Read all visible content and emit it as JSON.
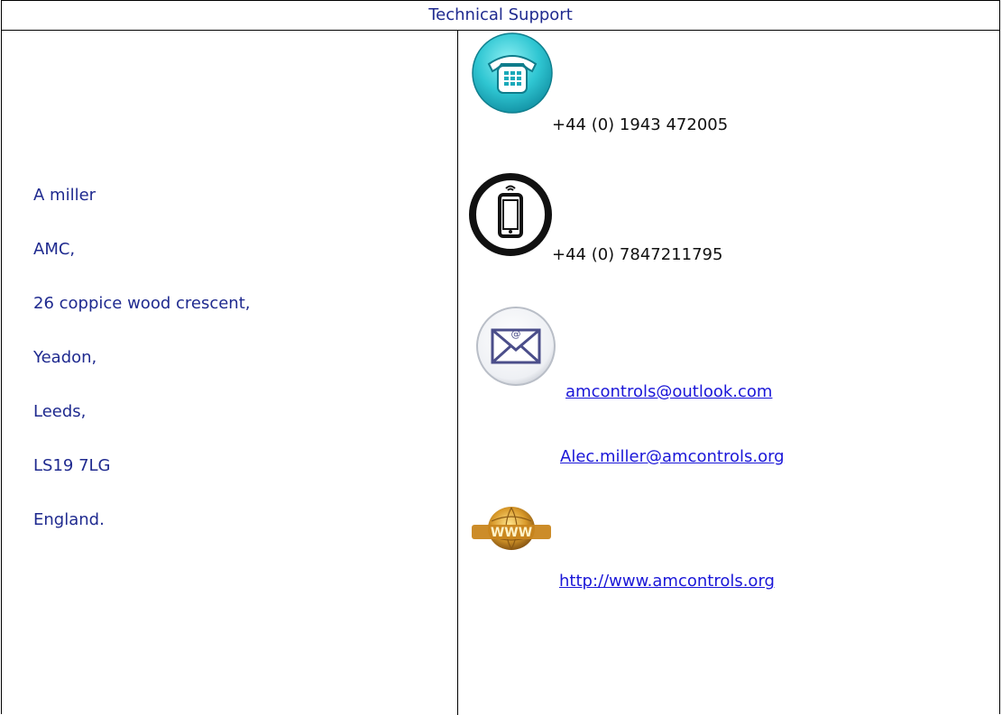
{
  "header": {
    "title": "Technical Support"
  },
  "address": {
    "lines": [
      "A miller",
      "AMC,",
      "26 coppice wood crescent,",
      "Yeadon,",
      "Leeds,",
      "LS19 7LG",
      "England."
    ]
  },
  "contact": {
    "phone": "+44 (0) 1943 472005",
    "mobile": "+44 (0) 7847211795",
    "email1": "amcontrols@outlook.com",
    "email2": "Alec.miller@amcontrols.org",
    "website": "http://www.amcontrols.org",
    "icons": [
      "phone-icon",
      "mobile-icon",
      "email-icon",
      "www-globe-icon"
    ]
  },
  "colors": {
    "address_text": "#1f2a8f",
    "link": "#1a16d8",
    "border": "#000000"
  }
}
